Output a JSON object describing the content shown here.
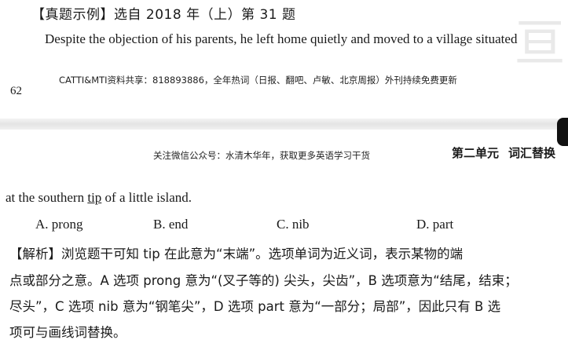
{
  "top_page": {
    "heading": "【真题示例】选自 2018 年（上）第 31 题",
    "question_line1": "Despite the objection of his parents, he left home quietly and moved to a village situated",
    "footer_note": "CATTI&MTI资料共享：818893886，全年热词（日报、翻吧、卢敏、北京周报）外刊持续免费更新",
    "page_number": "62"
  },
  "bottom_page": {
    "header_note": "关注微信公众号：水清木华年，获取更多英语学习干货",
    "unit_title": {
      "unit": "第二单元",
      "topic": "词汇替换"
    },
    "question_cont": {
      "before": "at the southern ",
      "underlined": "tip",
      "after": " of a little island."
    },
    "options": [
      "A. prong",
      "B. end",
      "C. nib",
      "D. part"
    ],
    "analysis_lines": [
      "【解析】浏览题干可知 tip 在此意为“末端”。选项单词为近义词，表示某物的端",
      "点或部分之意。A 选项 prong 意为“(叉子等的) 尖头，尖齿”，B 选项意为“结尾，结束；",
      "尽头”，C 选项 nib 意为“钢笔尖”，D 选项 part 意为“一部分；局部”，因此只有 B 选",
      "项可与画线词替换。"
    ]
  }
}
